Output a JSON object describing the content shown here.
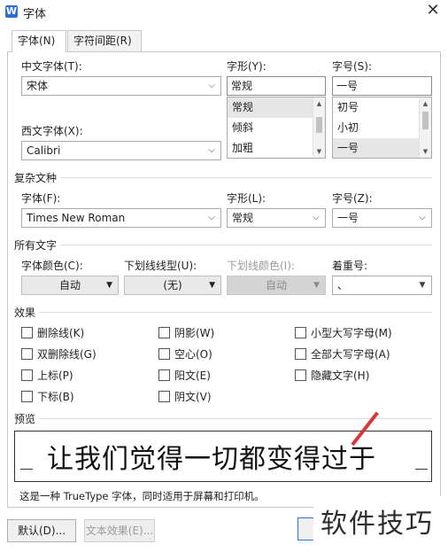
{
  "window": {
    "title": "字体",
    "app_icon_letter": "W",
    "close_glyph": "✕"
  },
  "tabs": [
    {
      "label": "字体(N)",
      "active": true
    },
    {
      "label": "字符间距(R)",
      "active": false
    }
  ],
  "chinese_font": {
    "label": "中文字体(T):",
    "value": "宋体"
  },
  "western_font": {
    "label": "西文字体(X):",
    "value": "Calibri"
  },
  "style": {
    "label": "字形(Y):",
    "value": "常规",
    "options": [
      "常规",
      "倾斜",
      "加粗"
    ],
    "selected_index": 0
  },
  "size": {
    "label": "字号(S):",
    "value": "一号",
    "options": [
      "初号",
      "小初",
      "一号"
    ],
    "selected_index": 2
  },
  "complex": {
    "section_title": "复杂文种",
    "font_label": "字体(F):",
    "font_value": "Times New Roman",
    "style_label": "字形(L):",
    "style_value": "常规",
    "size_label": "字号(Z):",
    "size_value": "一号"
  },
  "all_text": {
    "section_title": "所有文字",
    "font_color_label": "字体颜色(C):",
    "font_color_value": "自动",
    "underline_type_label": "下划线线型(U):",
    "underline_type_value": "(无)",
    "underline_color_label": "下划线颜色(I):",
    "underline_color_value": "自动",
    "emphasis_label": "着重号:",
    "emphasis_value": "、"
  },
  "effects": {
    "section_title": "效果",
    "items": [
      "删除线(K)",
      "双删除线(G)",
      "上标(P)",
      "下标(B)",
      "阴影(W)",
      "空心(O)",
      "阳文(E)",
      "阴文(V)",
      "小型大写字母(M)",
      "全部大写字母(A)",
      "隐藏文字(H)"
    ]
  },
  "preview": {
    "section_title": "预览",
    "text": "让我们觉得一切都变得过于",
    "note": "这是一种 TrueType 字体，同时适用于屏幕和打印机。"
  },
  "buttons": {
    "default": "默认(D)...",
    "text_effects": "文本效果(E)..."
  },
  "watermark": "软件技巧",
  "colors": {
    "accent": "#2f6fd6",
    "selection": "#e6e6e6",
    "annotation_red": "#d9383a"
  }
}
